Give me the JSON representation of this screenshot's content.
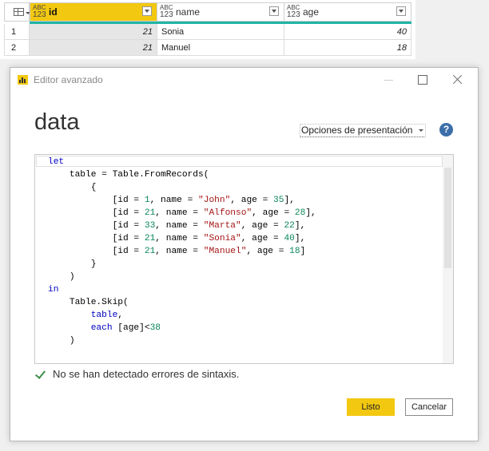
{
  "grid": {
    "columns": [
      {
        "type_top": "ABC",
        "type_bottom": "123",
        "name": "id",
        "active": true
      },
      {
        "type_top": "ABC",
        "type_bottom": "123",
        "name": "name",
        "active": false
      },
      {
        "type_top": "ABC",
        "type_bottom": "123",
        "name": "age",
        "active": false
      }
    ],
    "rows": [
      {
        "num": "1",
        "id": "21",
        "name": "Sonia",
        "age": "40"
      },
      {
        "num": "2",
        "id": "21",
        "name": "Manuel",
        "age": "18"
      }
    ],
    "colors": {
      "active_header": "#f2c811",
      "accent_bar": "#21b4a6"
    }
  },
  "dialog": {
    "title": "Editor avanzado",
    "query_name": "data",
    "display_options": "Opciones de presentación",
    "help_label": "?",
    "code_lines": [
      [
        {
          "t": "let",
          "c": "kw"
        }
      ],
      [
        {
          "t": "    table = Table.FromRecords("
        }
      ],
      [
        {
          "t": "        {"
        }
      ],
      [
        {
          "t": "            [id = "
        },
        {
          "t": "1",
          "c": "num"
        },
        {
          "t": ", name = "
        },
        {
          "t": "\"John\"",
          "c": "str"
        },
        {
          "t": ", age = "
        },
        {
          "t": "35",
          "c": "num"
        },
        {
          "t": "],"
        }
      ],
      [
        {
          "t": "            [id = "
        },
        {
          "t": "21",
          "c": "num"
        },
        {
          "t": ", name = "
        },
        {
          "t": "\"Alfonso\"",
          "c": "str"
        },
        {
          "t": ", age = "
        },
        {
          "t": "28",
          "c": "num"
        },
        {
          "t": "],"
        }
      ],
      [
        {
          "t": "            [id = "
        },
        {
          "t": "33",
          "c": "num"
        },
        {
          "t": ", name = "
        },
        {
          "t": "\"Marta\"",
          "c": "str"
        },
        {
          "t": ", age = "
        },
        {
          "t": "22",
          "c": "num"
        },
        {
          "t": "],"
        }
      ],
      [
        {
          "t": "            [id = "
        },
        {
          "t": "21",
          "c": "num"
        },
        {
          "t": ", name = "
        },
        {
          "t": "\"Sonia\"",
          "c": "str"
        },
        {
          "t": ", age = "
        },
        {
          "t": "40",
          "c": "num"
        },
        {
          "t": "],"
        }
      ],
      [
        {
          "t": "            [id = "
        },
        {
          "t": "21",
          "c": "num"
        },
        {
          "t": ", name = "
        },
        {
          "t": "\"Manuel\"",
          "c": "str"
        },
        {
          "t": ", age = "
        },
        {
          "t": "18",
          "c": "num"
        },
        {
          "t": "]"
        }
      ],
      [
        {
          "t": "        }"
        }
      ],
      [
        {
          "t": "    )"
        }
      ],
      [
        {
          "t": "in",
          "c": "kw"
        }
      ],
      [
        {
          "t": "    Table.Skip("
        }
      ],
      [
        {
          "t": "        "
        },
        {
          "t": "table",
          "c": "kw"
        },
        {
          "t": ","
        }
      ],
      [
        {
          "t": "        "
        },
        {
          "t": "each",
          "c": "kw"
        },
        {
          "t": " [age]<"
        },
        {
          "t": "38",
          "c": "num"
        }
      ],
      [
        {
          "t": "    )"
        }
      ]
    ],
    "status_text": "No se han detectado errores de sintaxis.",
    "ok_label": "Listo",
    "cancel_label": "Cancelar",
    "colors": {
      "keyword": "#0000c0",
      "string": "#a31515",
      "number": "#098658",
      "ok_button": "#f2c811",
      "success_check": "#3e8f4a"
    }
  }
}
